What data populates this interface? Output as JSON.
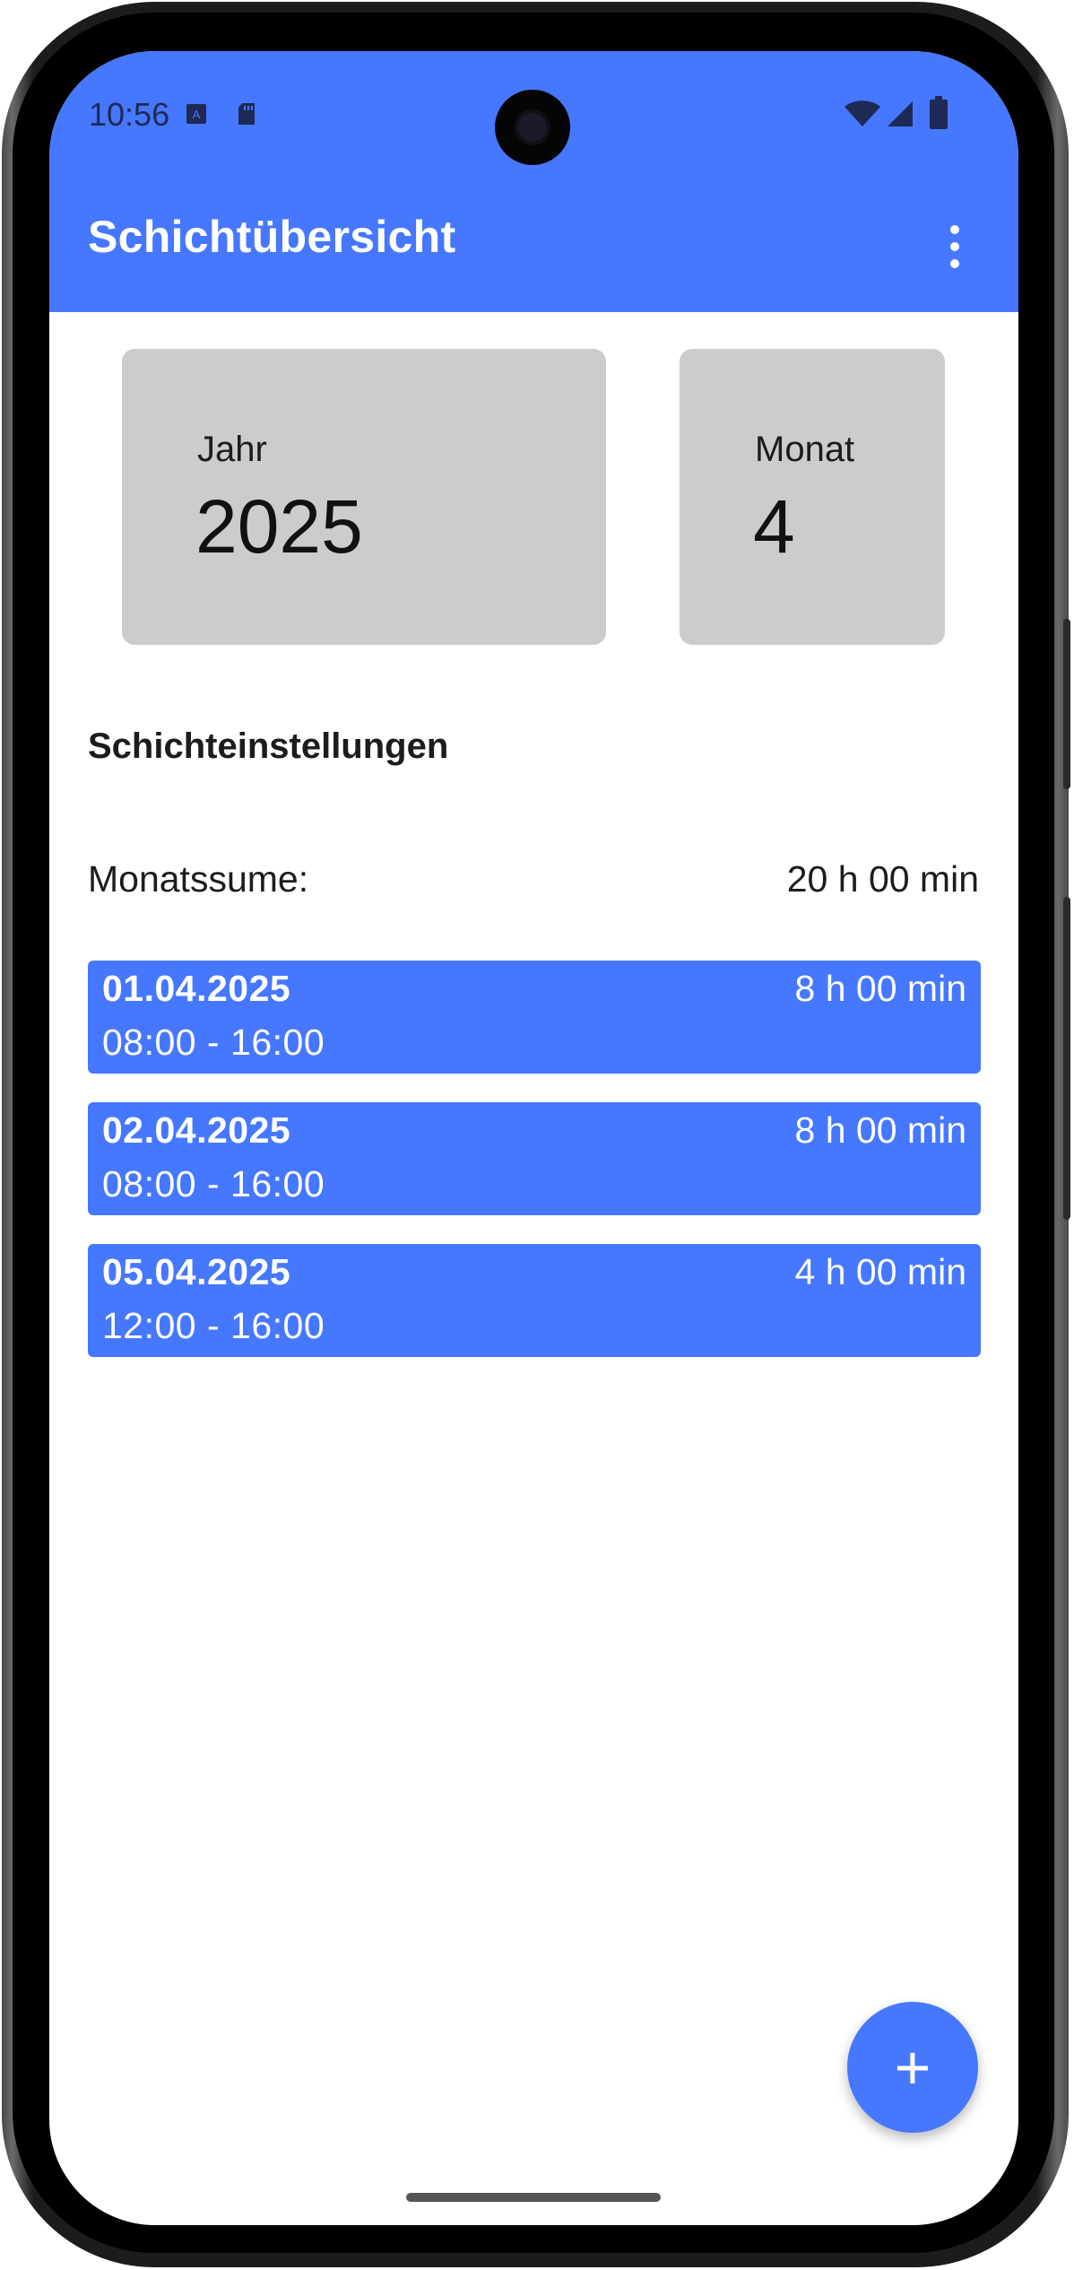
{
  "status_bar": {
    "time": "10:56"
  },
  "app_bar": {
    "title": "Schichtübersicht",
    "menu_icon": "more-vert-icon"
  },
  "selector": {
    "year_label": "Jahr",
    "year_value": "2025",
    "month_label": "Monat",
    "month_value": "4"
  },
  "section": {
    "title": "Schichteinstellungen"
  },
  "summary": {
    "label": "Monatssume:",
    "value": "20 h 00 min"
  },
  "shifts": [
    {
      "date": "01.04.2025",
      "duration": "8 h 00 min",
      "time": "08:00 - 16:00"
    },
    {
      "date": "02.04.2025",
      "duration": "8 h 00 min",
      "time": "08:00 - 16:00"
    },
    {
      "date": "05.04.2025",
      "duration": "4 h 00 min",
      "time": "12:00 - 16:00"
    }
  ],
  "fab": {
    "icon": "add-icon",
    "symbol": "+"
  },
  "colors": {
    "primary": "#4677FF",
    "card": "#CCCCCC"
  }
}
